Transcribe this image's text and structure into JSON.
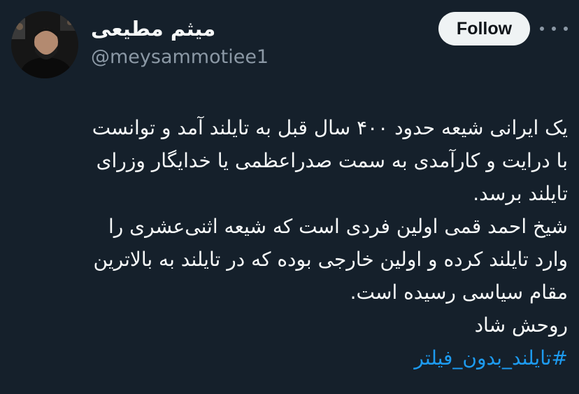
{
  "author": {
    "display_name": "میثم مطیعی",
    "handle": "@meysammotiee1"
  },
  "actions": {
    "follow_label": "Follow",
    "more_icon": "more-horizontal-icon"
  },
  "tweet": {
    "lines": [
      "یک ایرانی شیعه حدود ۴۰۰ سال قبل به تایلند آمد و توانست",
      "با درایت و کارآمدی به سمت صدراعظمی یا خدایگار وزرای",
      "تایلند برسد.",
      "شیخ احمد قمی اولین فردی است که شیعه اثنی‌عشری را",
      "وارد تایلند کرده و اولین خارجی بوده که در تایلند به بالاترین",
      "مقام سیاسی رسیده است.",
      "روحش شاد"
    ],
    "hashtag": "#تایلند_بدون_فیلتر"
  },
  "colors": {
    "background": "#15202b",
    "text": "#f7f9f9",
    "secondary_text": "#8b98a5",
    "link": "#1d9bf0",
    "follow_bg": "#eff3f4"
  }
}
